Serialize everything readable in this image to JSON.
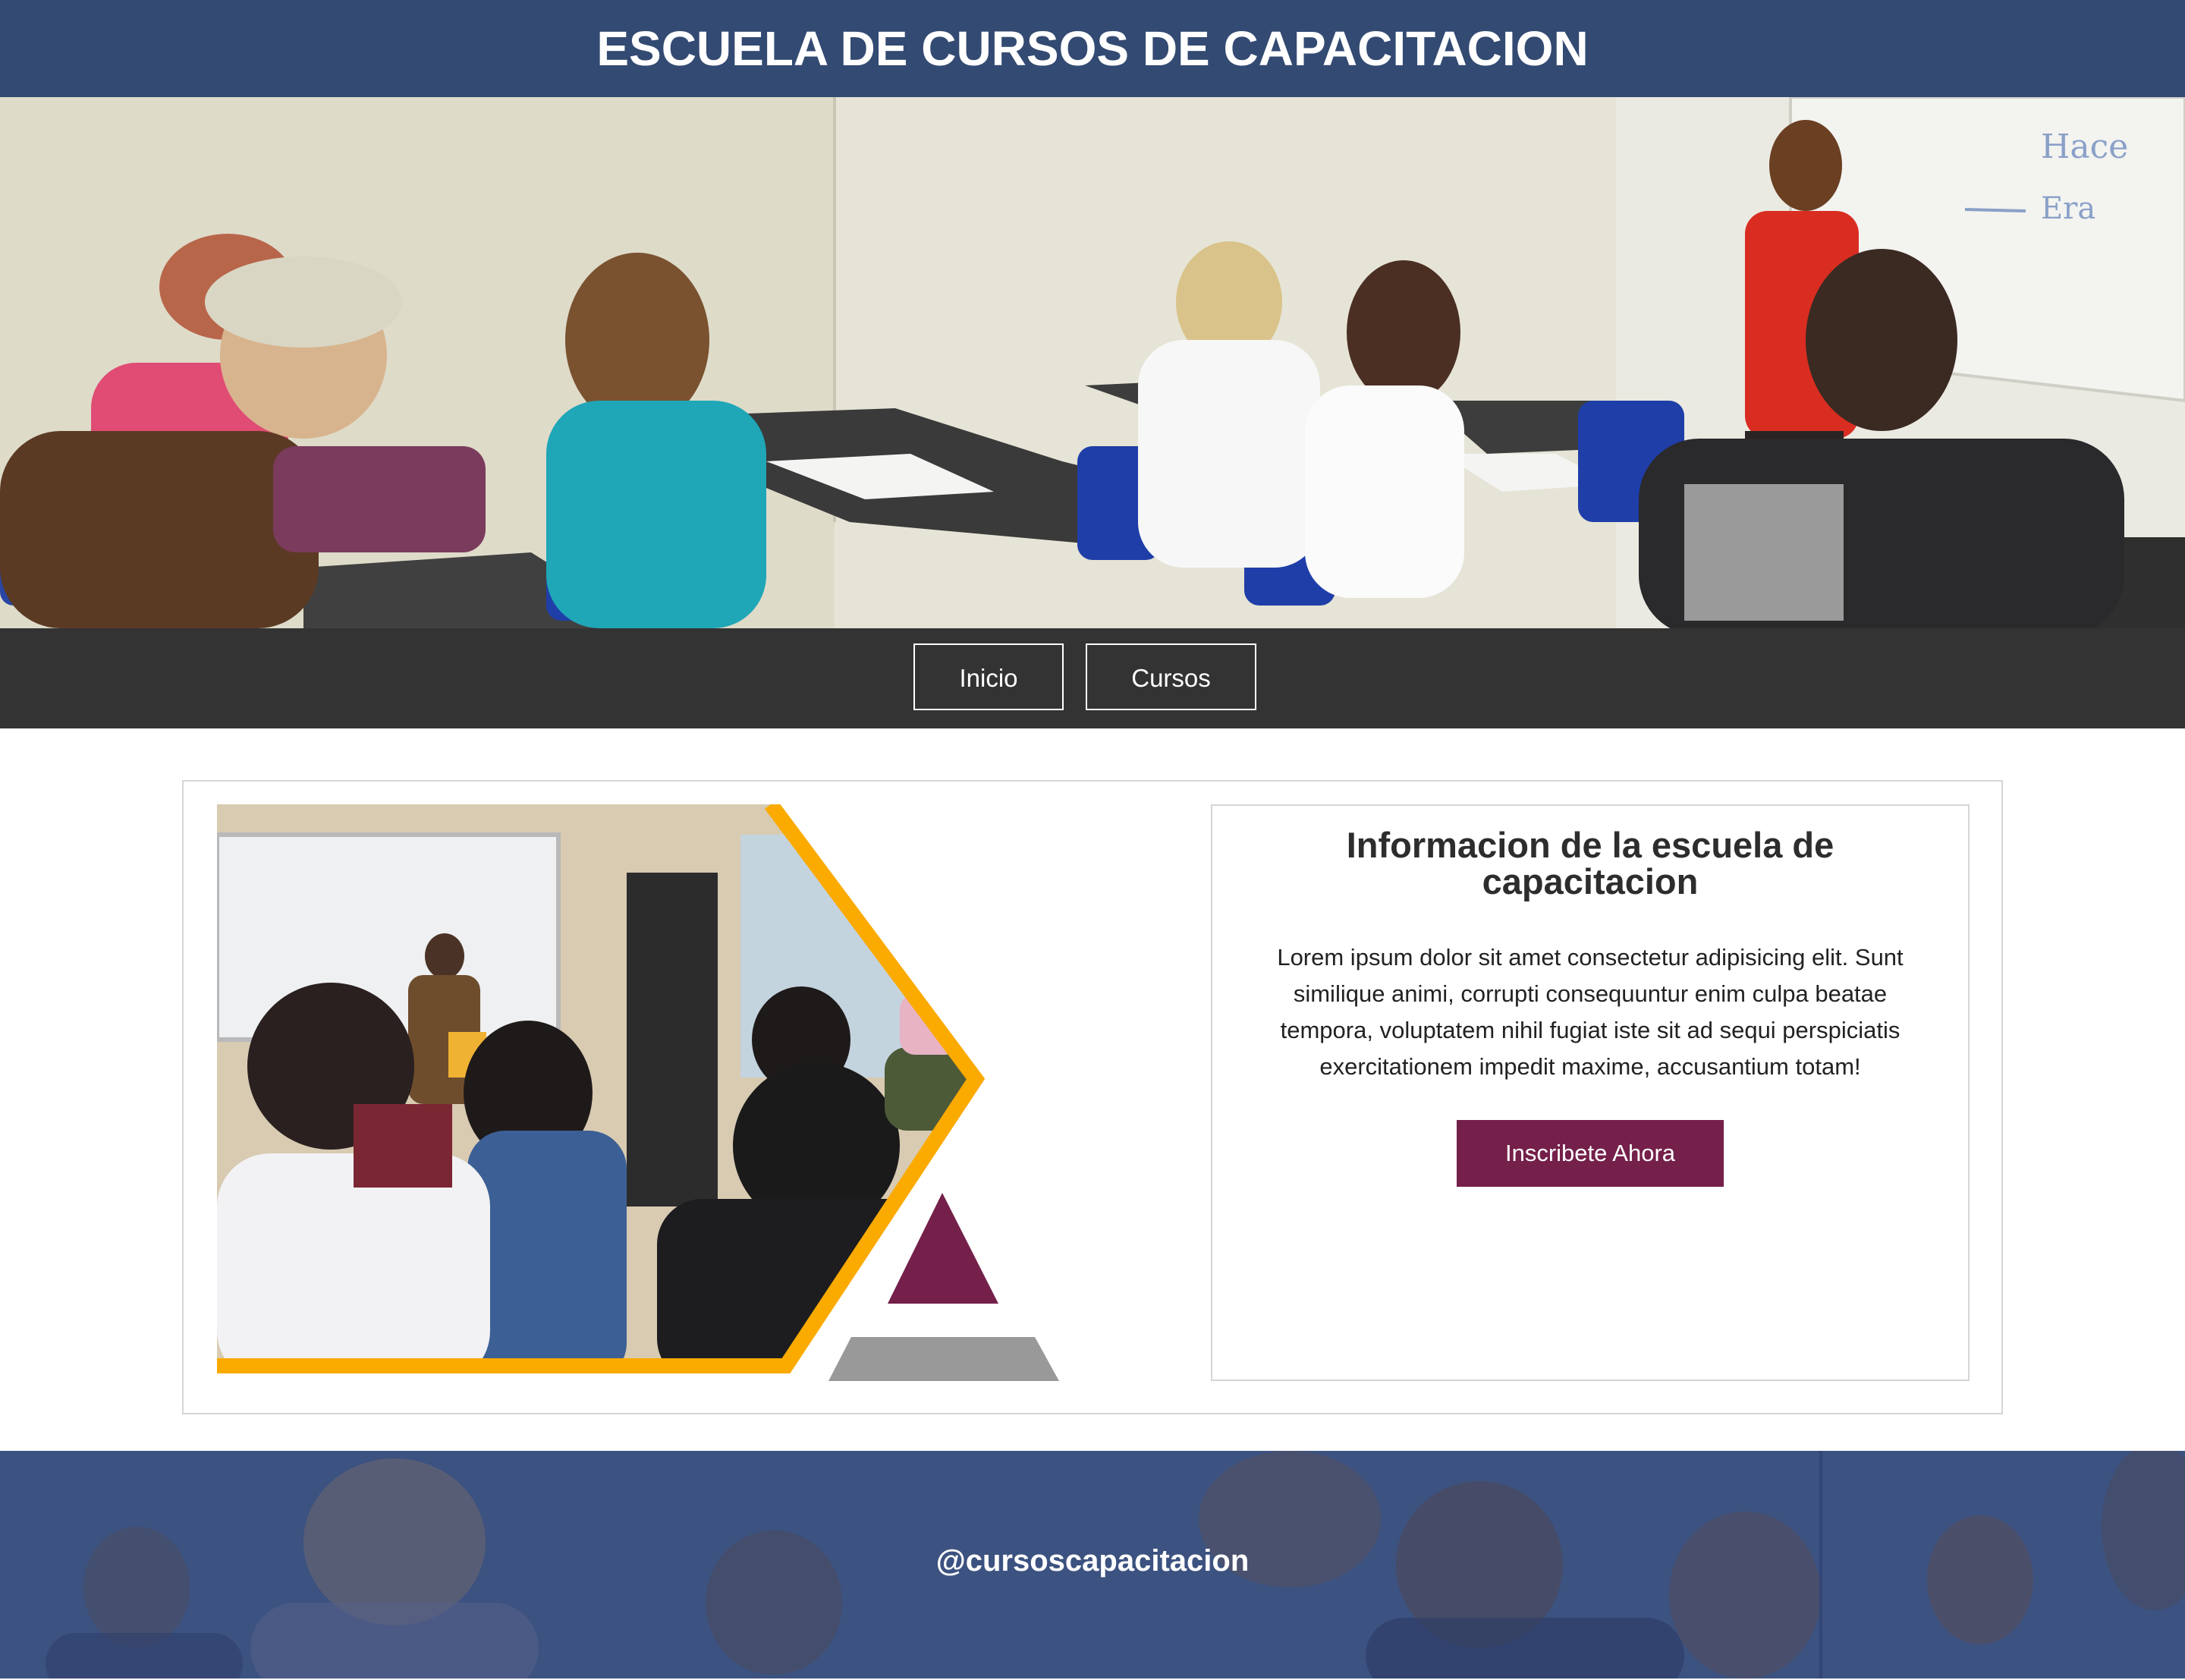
{
  "header": {
    "title": "ESCUELA DE CURSOS DE CAPACITACION"
  },
  "hero": {
    "image": "classroom-photo",
    "whiteboard_text": [
      "Hace",
      "Era"
    ]
  },
  "nav": {
    "items": [
      {
        "label": "Inicio"
      },
      {
        "label": "Cursos"
      }
    ]
  },
  "info": {
    "title": "Informacion de la escuela de capacitacion",
    "body": "Lorem ipsum dolor sit amet consectetur adipisicing elit. Sunt similique animi, corrupti consequuntur enim culpa beatae tempora, voluptatem nihil fugiat iste sit ad sequi perspiciatis exercitationem impedit maxime, accusantium totam!",
    "cta_label": "Inscribete Ahora"
  },
  "footer": {
    "handle": "@cursoscapacitacion"
  },
  "colors": {
    "header_bg": "#334a72",
    "nav_bg": "#333333",
    "cta_bg": "#74204a",
    "accent_yellow": "#fbaa00",
    "accent_gray": "#999999",
    "footer_overlay": "#3c5280"
  }
}
